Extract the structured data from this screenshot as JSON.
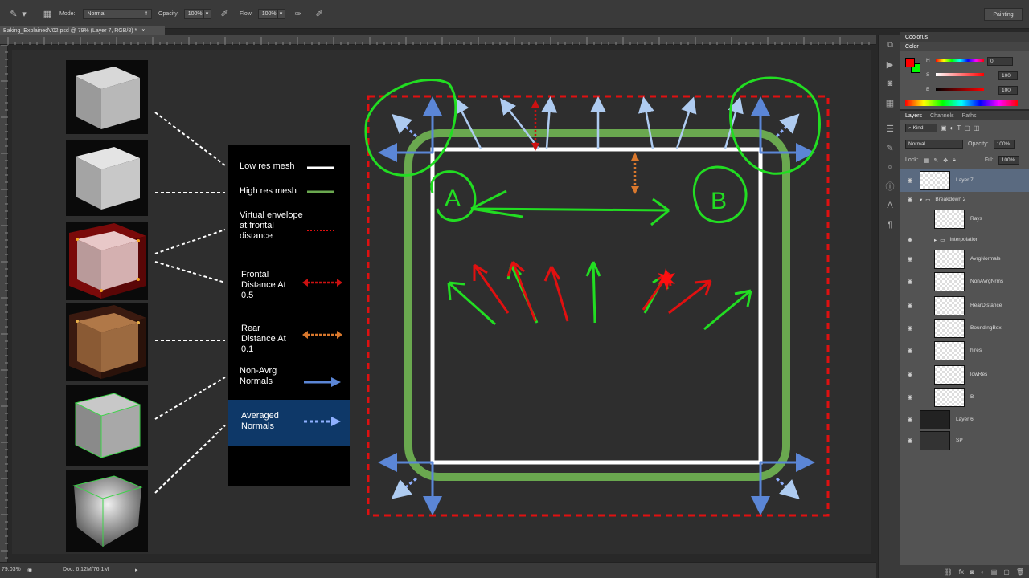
{
  "options_bar": {
    "mode_label": "Mode:",
    "mode_value": "Normal",
    "opacity_label": "Opacity:",
    "opacity_value": "100%",
    "flow_label": "Flow:",
    "flow_value": "100%",
    "workspace": "Painting"
  },
  "document": {
    "tab_title": "Baking_ExplainedV02.psd @ 79% (Layer 7, RGB/8) *",
    "close": "×"
  },
  "status": {
    "zoom": "79.03%",
    "doc_size": "Doc: 6.12M/76.1M"
  },
  "panels": {
    "group_title": "Coolorus",
    "color_tab": "Color",
    "color": {
      "foreground": "#ff0000",
      "background": "#00ff00",
      "h_label": "H",
      "s_label": "S",
      "b_label": "B",
      "h_value": "0",
      "s_value": "100",
      "b_value": "100",
      "h_fraction": 0,
      "s_fraction": 1.0,
      "b_fraction": 1.0
    },
    "layer_tabs": [
      "Layers",
      "Channels",
      "Paths"
    ],
    "kind_label": "Kind",
    "blend_mode": "Normal",
    "opacity_label": "Opacity:",
    "opacity_value": "100%",
    "lock_label": "Lock:",
    "fill_label": "Fill:",
    "fill_value": "100%"
  },
  "layers": [
    {
      "name": "Layer 7",
      "selected": true,
      "visible": true,
      "indent": 0
    },
    {
      "name": "Breakdown 2",
      "group": true,
      "visible": true,
      "indent": 0
    },
    {
      "name": "Rays",
      "visible": false,
      "indent": 1
    },
    {
      "name": "Interpolation",
      "group": true,
      "visible": true,
      "indent": 1
    },
    {
      "name": "AvrgNormals",
      "visible": true,
      "indent": 1
    },
    {
      "name": "NonAVrgNrms",
      "visible": true,
      "indent": 1
    },
    {
      "name": "RearDistance",
      "visible": true,
      "indent": 1
    },
    {
      "name": "BoundingBox",
      "visible": true,
      "indent": 1
    },
    {
      "name": "hires",
      "visible": true,
      "indent": 1
    },
    {
      "name": "lowRes",
      "visible": true,
      "indent": 1
    },
    {
      "name": "B",
      "visible": true,
      "indent": 1
    },
    {
      "name": "Layer 6",
      "visible": true,
      "indent": 0
    },
    {
      "name": "SP",
      "visible": true,
      "indent": 0
    }
  ],
  "legend": {
    "low_res": "Low res mesh",
    "high_res": "High res mesh",
    "envelope": "Virtual envelope at frontal distance",
    "frontal": "Frontal Distance At 0.5",
    "rear": "Rear Distance At 0.1",
    "non_avrg": "Non-Avrg Normals",
    "averaged": "Averaged Normals"
  },
  "annotations": {
    "circle_a": "A",
    "circle_b": "B"
  },
  "colors": {
    "low_res_line": "#ffffff",
    "high_res_line": "#6aa84f",
    "envelope": "#e01010",
    "frontal_arrow": "#cc1111",
    "rear_arrow": "#d9782d",
    "normals": "#5b86d6",
    "annotation": "#22dd22",
    "highlight": "#0e3868"
  }
}
